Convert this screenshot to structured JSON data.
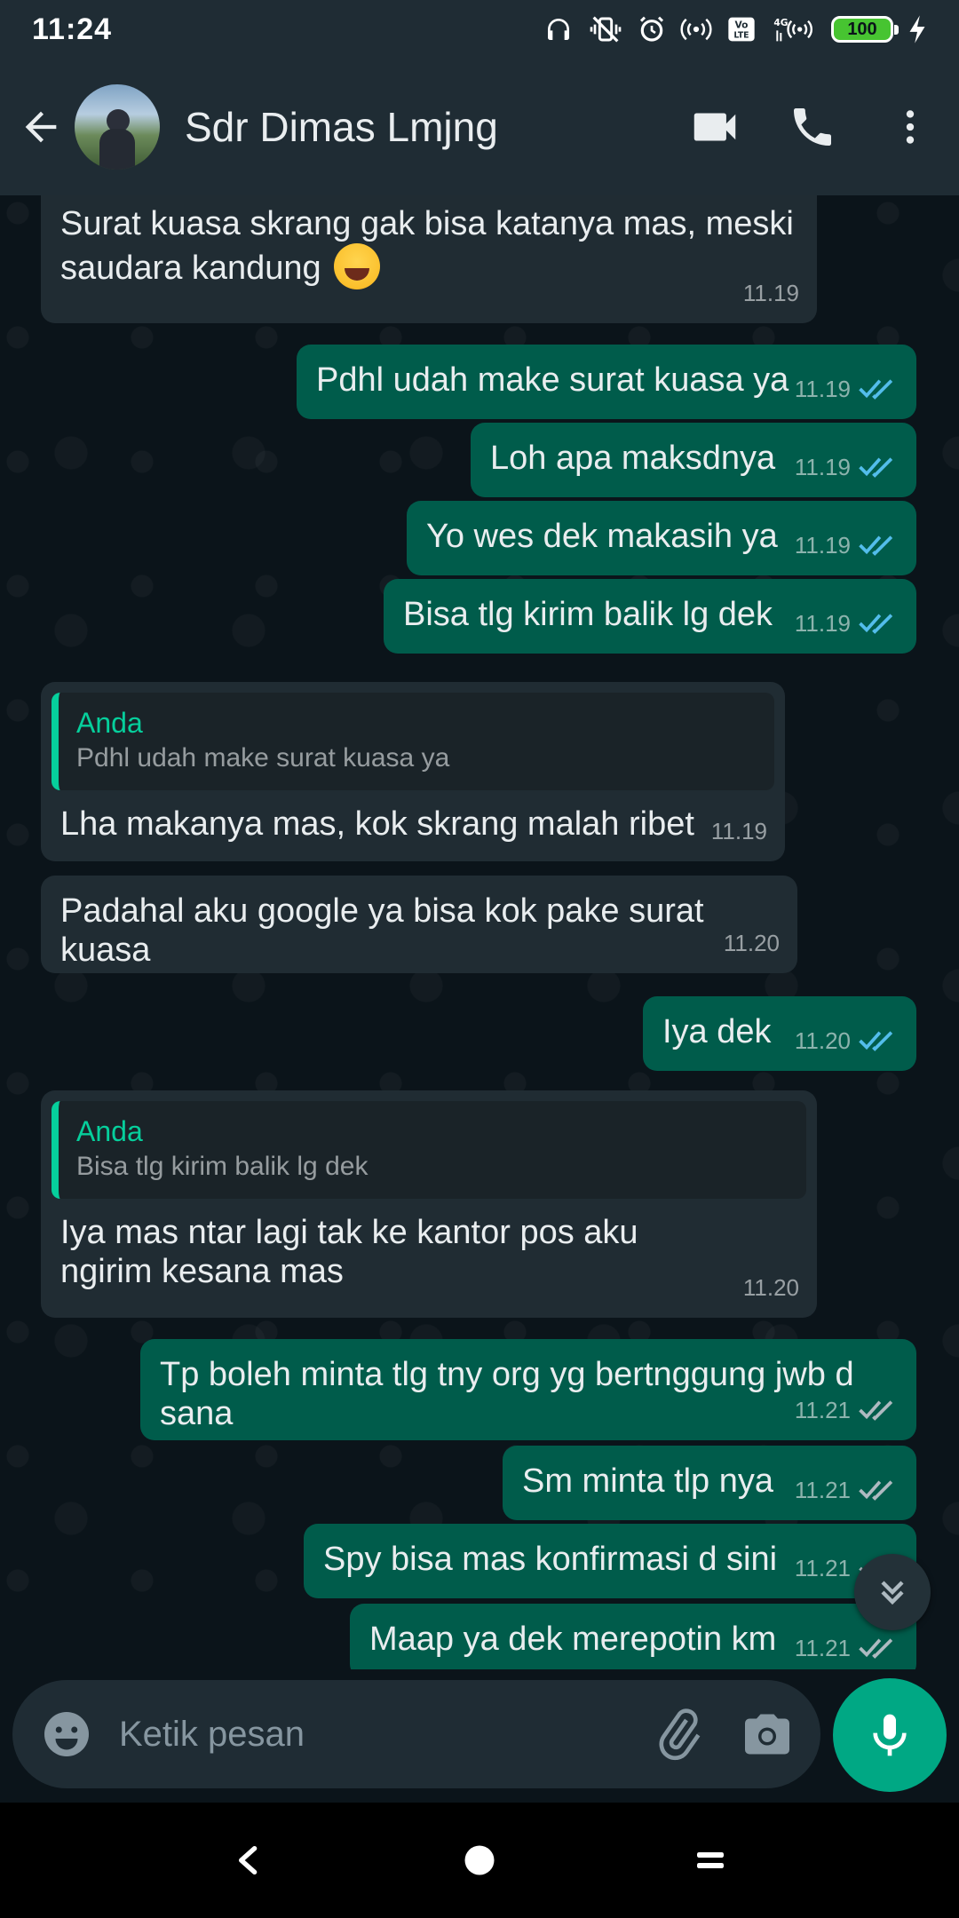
{
  "status_bar": {
    "time": "11:24",
    "battery": "100",
    "network": "4G",
    "volte": "Vo LTE"
  },
  "header": {
    "contact_name": "Sdr Dimas Lmjng",
    "icons": [
      "back-arrow-icon",
      "video-call-icon",
      "phone-icon",
      "more-vert-icon"
    ]
  },
  "colors": {
    "incoming_bubble": "#202c33",
    "outgoing_bubble": "#005c4b",
    "accent": "#00a884",
    "read_tick": "#53bdeb",
    "header_bg": "#1f2c34",
    "chat_bg": "#0b141a"
  },
  "messages": [
    {
      "dir": "in",
      "text": "Surat kuasa skrang gak bisa katanya mas, meski saudara kandung",
      "emoji": "face-with-tears-of-joy",
      "time": "11.19"
    },
    {
      "dir": "out",
      "text": "Pdhl udah make surat kuasa ya",
      "time": "11.19",
      "status": "read"
    },
    {
      "dir": "out",
      "text": "Loh apa maksdnya",
      "time": "11.19",
      "status": "read"
    },
    {
      "dir": "out",
      "text": "Yo wes dek makasih ya",
      "time": "11.19",
      "status": "read"
    },
    {
      "dir": "out",
      "text": "Bisa tlg kirim balik lg dek",
      "time": "11.19",
      "status": "read"
    },
    {
      "dir": "in",
      "quote_author": "Anda",
      "quote_text": "Pdhl udah make surat kuasa ya",
      "text": "Lha makanya mas, kok skrang malah ribet",
      "time": "11.19"
    },
    {
      "dir": "in",
      "text": "Padahal aku google ya bisa kok pake surat kuasa",
      "time": "11.20"
    },
    {
      "dir": "out",
      "text": "Iya dek",
      "time": "11.20",
      "status": "read"
    },
    {
      "dir": "in",
      "quote_author": "Anda",
      "quote_text": "Bisa tlg kirim balik lg dek",
      "text": "Iya mas ntar lagi tak ke kantor pos aku ngirim kesana mas",
      "time": "11.20"
    },
    {
      "dir": "out",
      "text": "Tp boleh minta tlg tny org yg bertnggung jwb d sana",
      "time": "11.21",
      "status": "delivered"
    },
    {
      "dir": "out",
      "text": "Sm minta tlp nya",
      "time": "11.21",
      "status": "delivered"
    },
    {
      "dir": "out",
      "text": "Spy bisa mas konfirmasi d sini",
      "time": "11.21",
      "status": "delivered"
    },
    {
      "dir": "out",
      "text": "Maap ya dek merepotin km",
      "time": "11.21",
      "status": "delivered"
    }
  ],
  "composer": {
    "placeholder": "Ketik pesan"
  }
}
